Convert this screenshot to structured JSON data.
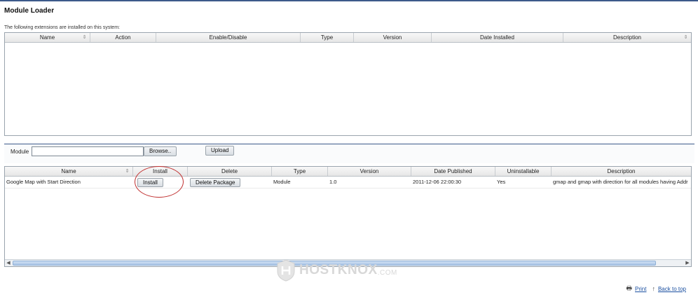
{
  "page": {
    "title": "Module Loader",
    "intro": "The following extensions are installed on this system:"
  },
  "installed_grid": {
    "columns": [
      "Name",
      "Action",
      "Enable/Disable",
      "Type",
      "Version",
      "Date Installed",
      "Description"
    ],
    "rows": []
  },
  "upload": {
    "module_label": "Module",
    "module_value": "",
    "browse_label": "Browse..",
    "upload_label": "Upload"
  },
  "modules_grid": {
    "columns": [
      "Name",
      "Install",
      "Delete",
      "Type",
      "Version",
      "Date Published",
      "Uninstallable",
      "Description"
    ],
    "rows": [
      {
        "name": "Google Map with Start Direction",
        "install_label": "Install",
        "delete_label": "Delete Package",
        "type": "Module",
        "version": "1.0",
        "date_published": "2011-12-06 22:00:30",
        "uninstallable": "Yes",
        "description": "gmap and gmap with direction for all modules having Addr"
      }
    ]
  },
  "watermark": {
    "text": "HOSTKNOX",
    "domain": ".COM"
  },
  "footer": {
    "print_label": "Print",
    "back_to_top_label": "Back to top"
  },
  "icons": {
    "sort": "sort-arrows-icon",
    "print": "printer-icon",
    "back_to_top": "arrow-up-icon"
  }
}
